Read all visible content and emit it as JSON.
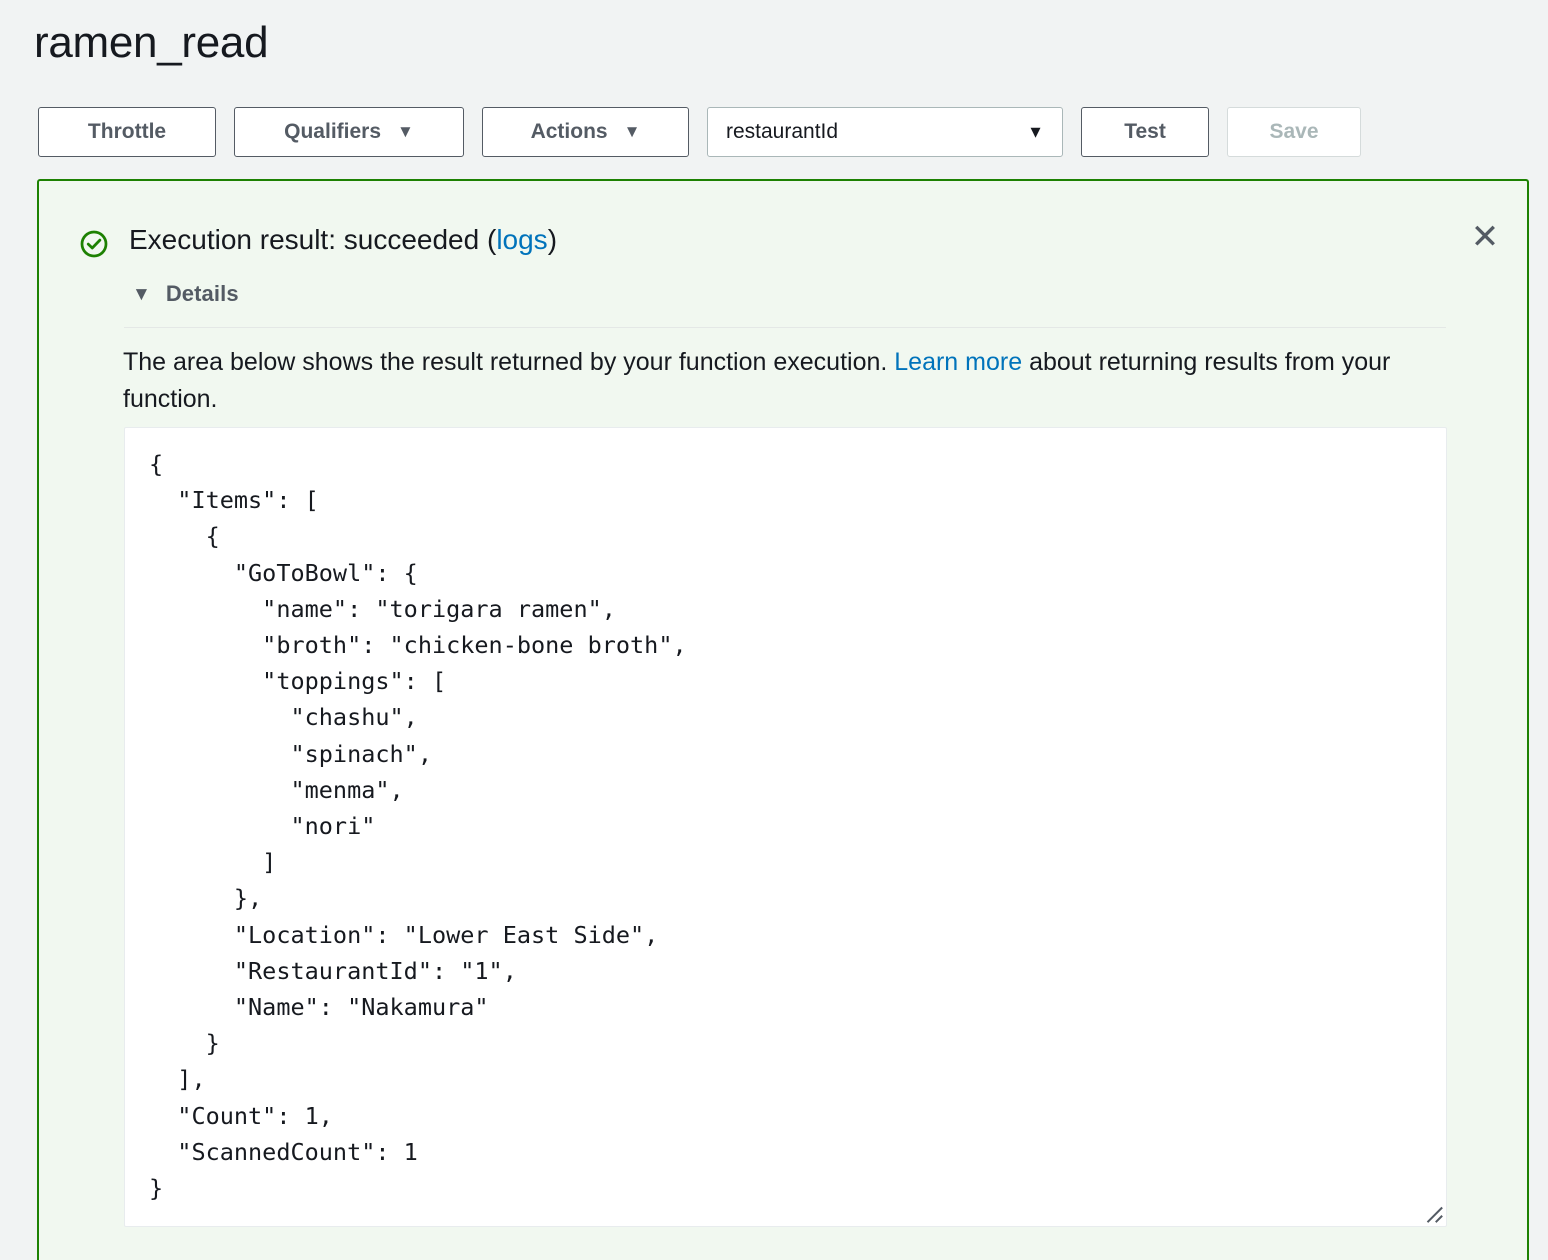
{
  "header": {
    "function_name": "ramen_read"
  },
  "toolbar": {
    "throttle_label": "Throttle",
    "qualifiers_label": "Qualifiers",
    "actions_label": "Actions",
    "test_event_selected": "restaurantId",
    "test_label": "Test",
    "save_label": "Save",
    "caret": "▼"
  },
  "result": {
    "status_icon": "success-check-circle-icon",
    "title_prefix": "Execution result: succeeded (",
    "logs_link": "logs",
    "title_suffix": ")",
    "close_icon": "✕",
    "details_caret": "▼",
    "details_label": "Details",
    "description_before": "The area below shows the result returned by your function execution. ",
    "description_link": "Learn more",
    "description_after": " about returning results from your function.",
    "output": "{\n  \"Items\": [\n    {\n      \"GoToBowl\": {\n        \"name\": \"torigara ramen\",\n        \"broth\": \"chicken-bone broth\",\n        \"toppings\": [\n          \"chashu\",\n          \"spinach\",\n          \"menma\",\n          \"nori\"\n        ]\n      },\n      \"Location\": \"Lower East Side\",\n      \"RestaurantId\": \"1\",\n      \"Name\": \"Nakamura\"\n    }\n  ],\n  \"Count\": 1,\n  \"ScannedCount\": 1\n}"
  },
  "colors": {
    "page_background": "#f1f3f3",
    "panel_background": "#f1f8f0",
    "panel_border_success": "#1d8102",
    "link": "#0073bb",
    "button_border": "#545b64",
    "disabled_text": "#aab7b8"
  }
}
